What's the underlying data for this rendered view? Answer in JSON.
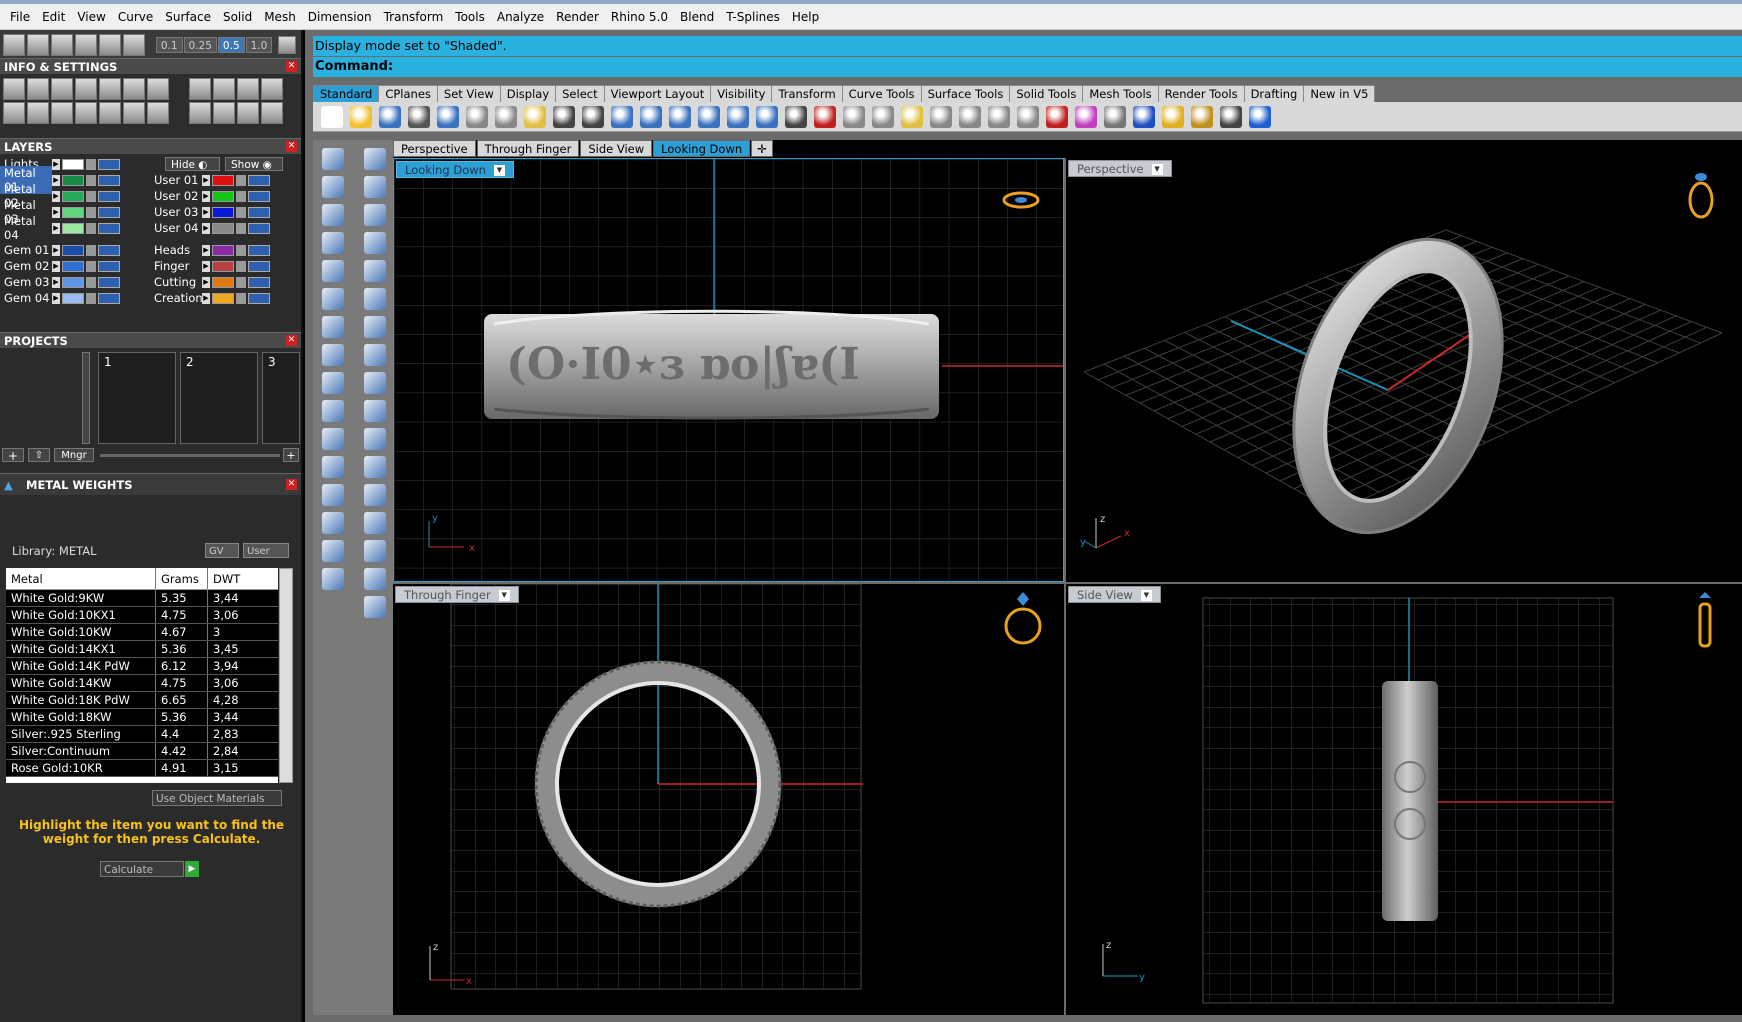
{
  "menu": [
    "File",
    "Edit",
    "View",
    "Curve",
    "Surface",
    "Solid",
    "Mesh",
    "Dimension",
    "Transform",
    "Tools",
    "Analyze",
    "Render",
    "Rhino 5.0",
    "Blend",
    "T-Splines",
    "Help"
  ],
  "snap_values": [
    "0.1",
    "0.25",
    "0.5",
    "1.0"
  ],
  "info_settings_title": "INFO & SETTINGS",
  "layers": {
    "title": "LAYERS",
    "lights_label": "Lights",
    "hide_label": "Hide",
    "show_label": "Show",
    "left": [
      {
        "name": "Metal 01",
        "color": "#1a8a4a",
        "selected": true
      },
      {
        "name": "Metal 02",
        "color": "#26a85a"
      },
      {
        "name": "Metal 03",
        "color": "#5fd67f"
      },
      {
        "name": "Metal 04",
        "color": "#9ee8a6"
      },
      {
        "name": "Gem 01",
        "color": "#1b4da8"
      },
      {
        "name": "Gem 02",
        "color": "#2c6ed4"
      },
      {
        "name": "Gem 03",
        "color": "#5f95e6"
      },
      {
        "name": "Gem 04",
        "color": "#9cbcef"
      }
    ],
    "right": [
      {
        "name": "User 01",
        "color": "#e01010"
      },
      {
        "name": "User 02",
        "color": "#17c317"
      },
      {
        "name": "User 03",
        "color": "#0a18d8"
      },
      {
        "name": "User 04",
        "color": "#8a8a8a"
      },
      {
        "name": "Heads",
        "color": "#8a2aa8"
      },
      {
        "name": "Finger",
        "color": "#b84040"
      },
      {
        "name": "Cutting",
        "color": "#e07810"
      },
      {
        "name": "Creation",
        "color": "#f0a818"
      }
    ]
  },
  "projects": {
    "title": "PROJECTS",
    "cells": [
      "1",
      "2",
      "3"
    ],
    "mngr_label": "Mngr"
  },
  "metal_weights": {
    "title": "METAL WEIGHTS",
    "library": "Library: METAL",
    "gv_label": "GV",
    "user_label": "User",
    "columns": [
      "Metal",
      "Grams",
      "DWT"
    ],
    "rows": [
      [
        "White Gold:9KW",
        "5.35",
        "3,44"
      ],
      [
        "White Gold:10KX1",
        "4.75",
        "3,06"
      ],
      [
        "White Gold:10KW",
        "4.67",
        "3"
      ],
      [
        "White Gold:14KX1",
        "5.36",
        "3,45"
      ],
      [
        "White Gold:14K PdW",
        "6.12",
        "3,94"
      ],
      [
        "White Gold:14KW",
        "4.75",
        "3,06"
      ],
      [
        "White Gold:18K PdW",
        "6.65",
        "4,28"
      ],
      [
        "White Gold:18KW",
        "5.36",
        "3,44"
      ],
      [
        "Silver:.925 Sterling",
        "4.4",
        "2,83"
      ],
      [
        "Silver:Continuum",
        "4.42",
        "2,84"
      ],
      [
        "Rose Gold:10KR",
        "4.91",
        "3,15"
      ]
    ],
    "use_object_materials": "Use Object Materials",
    "message": "Highlight the item you want to find the weight for then press Calculate.",
    "calculate_label": "Calculate"
  },
  "status": "Display mode set to \"Shaded\".",
  "command_label": "Command:",
  "toolbar_tabs": [
    "Standard",
    "CPlanes",
    "Set View",
    "Display",
    "Select",
    "Viewport Layout",
    "Visibility",
    "Transform",
    "Curve Tools",
    "Surface Tools",
    "Solid Tools",
    "Mesh Tools",
    "Render Tools",
    "Drafting",
    "New in V5"
  ],
  "viewport_tabs": [
    "Perspective",
    "Through Finger",
    "Side View",
    "Looking Down"
  ],
  "viewports": {
    "top_left": "Looking Down",
    "top_right": "Perspective",
    "bottom_left": "Through Finger",
    "bottom_right": "Side View"
  },
  "axis_labels": {
    "x": "x",
    "y": "y",
    "z": "z"
  }
}
